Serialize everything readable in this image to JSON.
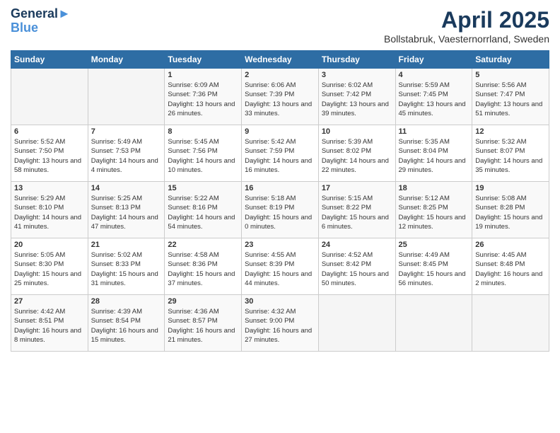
{
  "header": {
    "logo_line1": "General",
    "logo_line2": "Blue",
    "month_year": "April 2025",
    "location": "Bollstabruk, Vaesternorrland, Sweden"
  },
  "weekdays": [
    "Sunday",
    "Monday",
    "Tuesday",
    "Wednesday",
    "Thursday",
    "Friday",
    "Saturday"
  ],
  "weeks": [
    [
      {
        "num": "",
        "info": ""
      },
      {
        "num": "",
        "info": ""
      },
      {
        "num": "1",
        "info": "Sunrise: 6:09 AM\nSunset: 7:36 PM\nDaylight: 13 hours and 26 minutes."
      },
      {
        "num": "2",
        "info": "Sunrise: 6:06 AM\nSunset: 7:39 PM\nDaylight: 13 hours and 33 minutes."
      },
      {
        "num": "3",
        "info": "Sunrise: 6:02 AM\nSunset: 7:42 PM\nDaylight: 13 hours and 39 minutes."
      },
      {
        "num": "4",
        "info": "Sunrise: 5:59 AM\nSunset: 7:45 PM\nDaylight: 13 hours and 45 minutes."
      },
      {
        "num": "5",
        "info": "Sunrise: 5:56 AM\nSunset: 7:47 PM\nDaylight: 13 hours and 51 minutes."
      }
    ],
    [
      {
        "num": "6",
        "info": "Sunrise: 5:52 AM\nSunset: 7:50 PM\nDaylight: 13 hours and 58 minutes."
      },
      {
        "num": "7",
        "info": "Sunrise: 5:49 AM\nSunset: 7:53 PM\nDaylight: 14 hours and 4 minutes."
      },
      {
        "num": "8",
        "info": "Sunrise: 5:45 AM\nSunset: 7:56 PM\nDaylight: 14 hours and 10 minutes."
      },
      {
        "num": "9",
        "info": "Sunrise: 5:42 AM\nSunset: 7:59 PM\nDaylight: 14 hours and 16 minutes."
      },
      {
        "num": "10",
        "info": "Sunrise: 5:39 AM\nSunset: 8:02 PM\nDaylight: 14 hours and 22 minutes."
      },
      {
        "num": "11",
        "info": "Sunrise: 5:35 AM\nSunset: 8:04 PM\nDaylight: 14 hours and 29 minutes."
      },
      {
        "num": "12",
        "info": "Sunrise: 5:32 AM\nSunset: 8:07 PM\nDaylight: 14 hours and 35 minutes."
      }
    ],
    [
      {
        "num": "13",
        "info": "Sunrise: 5:29 AM\nSunset: 8:10 PM\nDaylight: 14 hours and 41 minutes."
      },
      {
        "num": "14",
        "info": "Sunrise: 5:25 AM\nSunset: 8:13 PM\nDaylight: 14 hours and 47 minutes."
      },
      {
        "num": "15",
        "info": "Sunrise: 5:22 AM\nSunset: 8:16 PM\nDaylight: 14 hours and 54 minutes."
      },
      {
        "num": "16",
        "info": "Sunrise: 5:18 AM\nSunset: 8:19 PM\nDaylight: 15 hours and 0 minutes."
      },
      {
        "num": "17",
        "info": "Sunrise: 5:15 AM\nSunset: 8:22 PM\nDaylight: 15 hours and 6 minutes."
      },
      {
        "num": "18",
        "info": "Sunrise: 5:12 AM\nSunset: 8:25 PM\nDaylight: 15 hours and 12 minutes."
      },
      {
        "num": "19",
        "info": "Sunrise: 5:08 AM\nSunset: 8:28 PM\nDaylight: 15 hours and 19 minutes."
      }
    ],
    [
      {
        "num": "20",
        "info": "Sunrise: 5:05 AM\nSunset: 8:30 PM\nDaylight: 15 hours and 25 minutes."
      },
      {
        "num": "21",
        "info": "Sunrise: 5:02 AM\nSunset: 8:33 PM\nDaylight: 15 hours and 31 minutes."
      },
      {
        "num": "22",
        "info": "Sunrise: 4:58 AM\nSunset: 8:36 PM\nDaylight: 15 hours and 37 minutes."
      },
      {
        "num": "23",
        "info": "Sunrise: 4:55 AM\nSunset: 8:39 PM\nDaylight: 15 hours and 44 minutes."
      },
      {
        "num": "24",
        "info": "Sunrise: 4:52 AM\nSunset: 8:42 PM\nDaylight: 15 hours and 50 minutes."
      },
      {
        "num": "25",
        "info": "Sunrise: 4:49 AM\nSunset: 8:45 PM\nDaylight: 15 hours and 56 minutes."
      },
      {
        "num": "26",
        "info": "Sunrise: 4:45 AM\nSunset: 8:48 PM\nDaylight: 16 hours and 2 minutes."
      }
    ],
    [
      {
        "num": "27",
        "info": "Sunrise: 4:42 AM\nSunset: 8:51 PM\nDaylight: 16 hours and 8 minutes."
      },
      {
        "num": "28",
        "info": "Sunrise: 4:39 AM\nSunset: 8:54 PM\nDaylight: 16 hours and 15 minutes."
      },
      {
        "num": "29",
        "info": "Sunrise: 4:36 AM\nSunset: 8:57 PM\nDaylight: 16 hours and 21 minutes."
      },
      {
        "num": "30",
        "info": "Sunrise: 4:32 AM\nSunset: 9:00 PM\nDaylight: 16 hours and 27 minutes."
      },
      {
        "num": "",
        "info": ""
      },
      {
        "num": "",
        "info": ""
      },
      {
        "num": "",
        "info": ""
      }
    ]
  ]
}
